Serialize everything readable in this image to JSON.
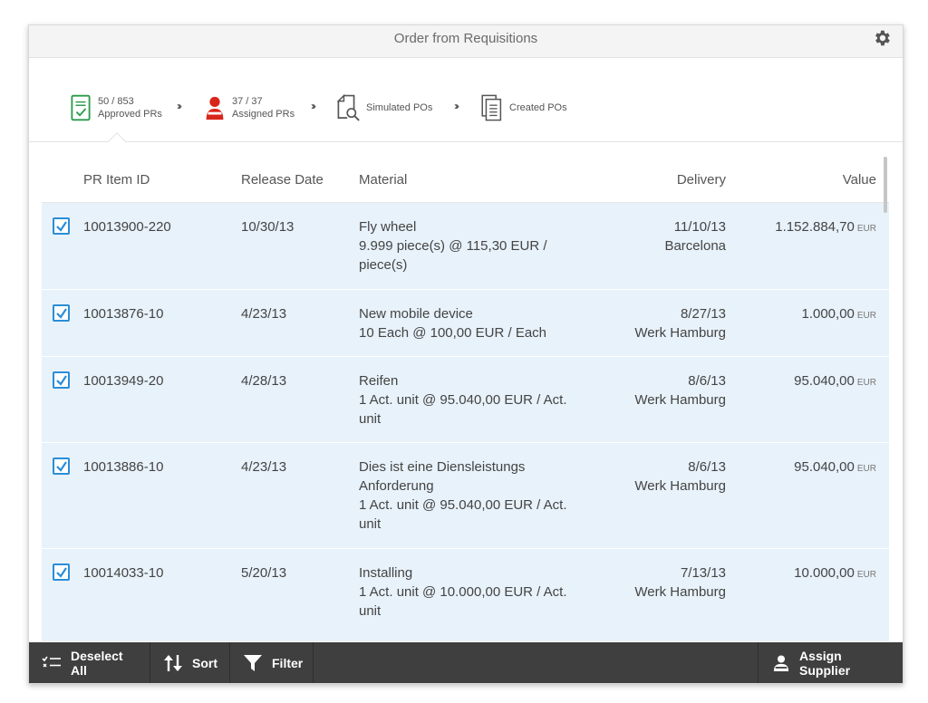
{
  "window": {
    "title": "Order from Requisitions"
  },
  "steps": [
    {
      "count": "50 / 853",
      "label": "Approved PRs",
      "icon": "approved-doc-icon"
    },
    {
      "count": "37 / 37",
      "label": "Assigned PRs",
      "icon": "person-icon"
    },
    {
      "count": "",
      "label": "Simulated POs",
      "icon": "search-doc-icon"
    },
    {
      "count": "",
      "label": "Created POs",
      "icon": "doc-stack-icon"
    }
  ],
  "table": {
    "headers": {
      "id": "PR Item ID",
      "date": "Release Date",
      "material": "Material",
      "delivery": "Delivery",
      "value": "Value"
    },
    "rows": [
      {
        "id": "10013900-220",
        "date": "10/30/13",
        "mat1": "Fly wheel",
        "mat2": "9.999 piece(s) @ 115,30 EUR /",
        "mat3": "piece(s)",
        "del_date": "11/10/13",
        "del_loc": "Barcelona",
        "value": "1.152.884,70",
        "cur": "EUR"
      },
      {
        "id": "10013876-10",
        "date": "4/23/13",
        "mat1": "New mobile device",
        "mat2": "10 Each @ 100,00 EUR / Each",
        "mat3": "",
        "del_date": "8/27/13",
        "del_loc": "Werk Hamburg",
        "value": "1.000,00",
        "cur": "EUR"
      },
      {
        "id": "10013949-20",
        "date": "4/28/13",
        "mat1": "Reifen",
        "mat2": "1 Act. unit @ 95.040,00 EUR / Act.",
        "mat3": "unit",
        "del_date": "8/6/13",
        "del_loc": "Werk Hamburg",
        "value": "95.040,00",
        "cur": "EUR"
      },
      {
        "id": "10013886-10",
        "date": "4/23/13",
        "mat1": "Dies ist eine Diensleistungs",
        "mat2": "Anforderung",
        "mat3": "1 Act. unit @ 95.040,00 EUR / Act.",
        "mat4": "unit",
        "del_date": "8/6/13",
        "del_loc": "Werk Hamburg",
        "value": "95.040,00",
        "cur": "EUR"
      },
      {
        "id": "10014033-10",
        "date": "5/20/13",
        "mat1": "Installing",
        "mat2": "1 Act. unit @ 10.000,00 EUR / Act.",
        "mat3": "unit",
        "del_date": "7/13/13",
        "del_loc": "Werk Hamburg",
        "value": "10.000,00",
        "cur": "EUR"
      }
    ]
  },
  "footer": {
    "deselect_all": "Deselect All",
    "sort": "Sort",
    "filter": "Filter",
    "assign_supplier": "Assign Supplier"
  },
  "colors": {
    "accent": "#2a8ed6",
    "row_bg": "#e8f2fa",
    "footer_bg": "#3f3f3f",
    "assigned_icon": "#d9261c",
    "approved_icon": "#2a9a4a"
  }
}
